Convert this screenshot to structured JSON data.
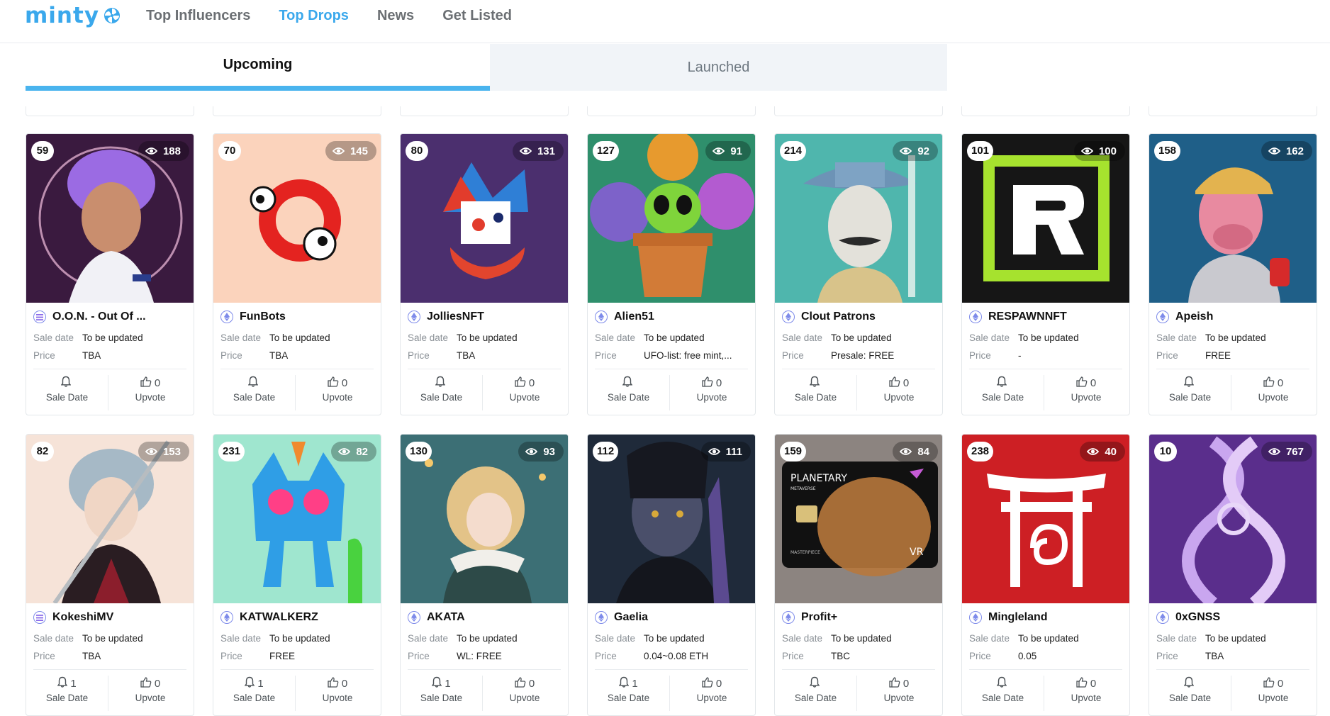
{
  "brand": {
    "name": "minty"
  },
  "nav": [
    {
      "label": "Top Influencers",
      "active": false
    },
    {
      "label": "Top Drops",
      "active": true
    },
    {
      "label": "News",
      "active": false
    },
    {
      "label": "Get Listed",
      "active": false
    }
  ],
  "tabs": {
    "upcoming": "Upcoming",
    "launched": "Launched",
    "active": "upcoming"
  },
  "labels": {
    "sale_date": "Sale date",
    "price": "Price",
    "sale_date_button": "Sale Date",
    "upvote_button": "Upvote"
  },
  "drops": [
    {
      "rank": "59",
      "views": "188",
      "name": "O.O.N. - Out Of ...",
      "chain": "solana",
      "sale_date": "To be updated",
      "price": "TBA",
      "reminders": "",
      "upvotes": "0",
      "image": "anime-purple-hair-girl",
      "bg": "#3a1a3f"
    },
    {
      "rank": "70",
      "views": "145",
      "name": "FunBots",
      "chain": "ethereum",
      "sale_date": "To be updated",
      "price": "TBA",
      "reminders": "",
      "upvotes": "0",
      "image": "red-ring-robot",
      "bg": "#fbd3bc"
    },
    {
      "rank": "80",
      "views": "131",
      "name": "JolliesNFT",
      "chain": "ethereum",
      "sale_date": "To be updated",
      "price": "TBA",
      "reminders": "",
      "upvotes": "0",
      "image": "pixel-jester",
      "bg": "#4b2f6e"
    },
    {
      "rank": "127",
      "views": "91",
      "name": "Alien51",
      "chain": "ethereum",
      "sale_date": "To be updated",
      "price": "UFO-list: free mint,...",
      "reminders": "",
      "upvotes": "0",
      "image": "green-alien-in-pot",
      "bg": "#2f8f6c"
    },
    {
      "rank": "214",
      "views": "92",
      "name": "Clout Patrons",
      "chain": "ethereum",
      "sale_date": "To be updated",
      "price": "Presale: FREE",
      "reminders": "",
      "upvotes": "0",
      "image": "cowboy-mask-character",
      "bg": "#4fb6ad"
    },
    {
      "rank": "101",
      "views": "100",
      "name": "RESPAWNNFT",
      "chain": "ethereum",
      "sale_date": "To be updated",
      "price": "-",
      "reminders": "",
      "upvotes": "0",
      "image": "respawn-r-logo",
      "bg": "#161616"
    },
    {
      "rank": "158",
      "views": "162",
      "name": "Apeish",
      "chain": "ethereum",
      "sale_date": "To be updated",
      "price": "FREE",
      "reminders": "",
      "upvotes": "0",
      "image": "ape-with-cap",
      "bg": "#1f5f88"
    },
    {
      "rank": "82",
      "views": "153",
      "name": "KokeshiMV",
      "chain": "solana",
      "sale_date": "To be updated",
      "price": "TBA",
      "reminders": "1",
      "upvotes": "0",
      "image": "anime-swordsman",
      "bg": "#f6e3d8"
    },
    {
      "rank": "231",
      "views": "82",
      "name": "KATWALKERZ",
      "chain": "ethereum",
      "sale_date": "To be updated",
      "price": "FREE",
      "reminders": "1",
      "upvotes": "0",
      "image": "blue-striped-cat",
      "bg": "#9fe6cf"
    },
    {
      "rank": "130",
      "views": "93",
      "name": "AKATA",
      "chain": "ethereum",
      "sale_date": "To be updated",
      "price": "WL: FREE",
      "reminders": "1",
      "upvotes": "0",
      "image": "anime-girl-street",
      "bg": "#2e5f66"
    },
    {
      "rank": "112",
      "views": "111",
      "name": "Gaelia",
      "chain": "ethereum",
      "sale_date": "To be updated",
      "price": "0.04~0.08 ETH",
      "reminders": "1",
      "upvotes": "0",
      "image": "dark-elf-warrior",
      "bg": "#1f2a3a"
    },
    {
      "rank": "159",
      "views": "84",
      "name": "Profit+",
      "chain": "ethereum",
      "sale_date": "To be updated",
      "price": "TBC",
      "reminders": "",
      "upvotes": "0",
      "image": "planetary-card",
      "bg": "#8c8480",
      "card_text": {
        "line1": "PLANETARY",
        "line2": "METAVERSE",
        "line3": "MASTERPIECE",
        "badge": "VR"
      }
    },
    {
      "rank": "238",
      "views": "40",
      "name": "Mingleland",
      "chain": "ethereum",
      "sale_date": "To be updated",
      "price": "0.05",
      "reminders": "",
      "upvotes": "0",
      "image": "torii-gate-logo",
      "bg": "#cd1f24"
    },
    {
      "rank": "10",
      "views": "767",
      "name": "0xGNSS",
      "chain": "ethereum",
      "sale_date": "To be updated",
      "price": "TBA",
      "reminders": "",
      "upvotes": "0",
      "image": "dna-helix-g",
      "bg": "#5a2e8c"
    }
  ]
}
